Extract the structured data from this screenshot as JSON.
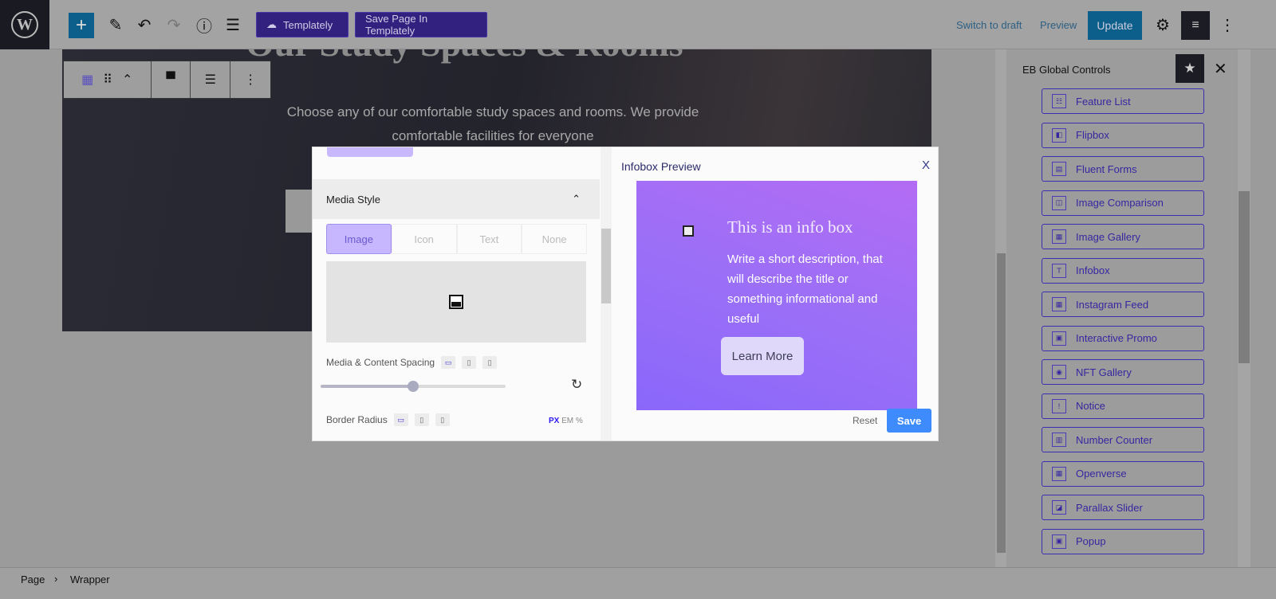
{
  "topbar": {
    "templately_label": "Templately",
    "save_template_label": "Save Page In Templately",
    "switch_draft": "Switch to draft",
    "preview": "Preview",
    "update": "Update",
    "wp_logo": "W"
  },
  "hero": {
    "title": "Our Study Spaces & Rooms",
    "subtitle": "Choose any of our comfortable study spaces and rooms. We provide comfortable facilities for everyone"
  },
  "sidebar": {
    "title": "EB Global Controls",
    "items": [
      "Feature List",
      "Flipbox",
      "Fluent Forms",
      "Image Comparison",
      "Image Gallery",
      "Infobox",
      "Instagram Feed",
      "Interactive Promo",
      "NFT Gallery",
      "Notice",
      "Number Counter",
      "Openverse",
      "Parallax Slider",
      "Popup"
    ]
  },
  "breadcrumb": {
    "page": "Page",
    "sep": "›",
    "current": "Wrapper"
  },
  "modal": {
    "media_style": "Media Style",
    "media_tabs": [
      "Image",
      "Icon",
      "Text",
      "None"
    ],
    "spacing_label": "Media & Content Spacing",
    "radius_label": "Border Radius",
    "units": [
      "PX",
      "EM",
      "%"
    ],
    "slider_value_fraction": 0.5,
    "preview_title": "Infobox Preview",
    "close": "X",
    "card_heading": "This is an info box",
    "card_desc": "Write a short description, that will describe the title or something informational and useful",
    "card_button": "Learn More",
    "reset": "Reset",
    "save": "Save"
  }
}
